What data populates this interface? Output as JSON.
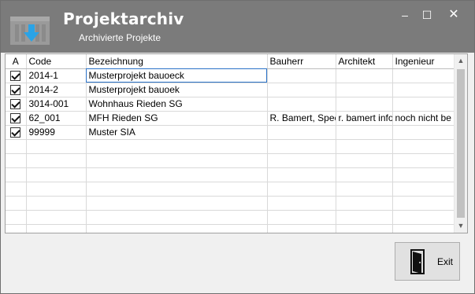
{
  "window": {
    "title": "Projektarchiv",
    "subtitle": "Archivierte Projekte",
    "controls": {
      "minimize": "–",
      "maximize": "☐",
      "close": "✕"
    },
    "colors": {
      "titlebar": "#7b7b7b",
      "accent_arrow": "#2aa3e6",
      "selection": "#2a72c8"
    }
  },
  "grid": {
    "columns": [
      "A",
      "Code",
      "Bezeichnung",
      "Bauherr",
      "Architekt",
      "Ingenieur"
    ],
    "rows": [
      {
        "checked": true,
        "code": "2014-1",
        "bezeichnung": "Musterprojekt bauoeck",
        "bauherr": "",
        "architekt": "",
        "ingenieur": ""
      },
      {
        "checked": true,
        "code": "2014-2",
        "bezeichnung": "Musterprojekt bauoek",
        "bauherr": "",
        "architekt": "",
        "ingenieur": ""
      },
      {
        "checked": true,
        "code": "3014-001",
        "bezeichnung": "Wohnhaus Rieden SG",
        "bauherr": "",
        "architekt": "",
        "ingenieur": ""
      },
      {
        "checked": true,
        "code": "62_001",
        "bezeichnung": "MFH Rieden SG",
        "bauherr": "R. Bamert, Spee",
        "architekt": "r. bamert info",
        "ingenieur": "noch nicht be"
      },
      {
        "checked": true,
        "code": "99999",
        "bezeichnung": "Muster SIA",
        "bauherr": "",
        "architekt": "",
        "ingenieur": ""
      }
    ],
    "empty_rows": 7,
    "selected_row": 0
  },
  "footer": {
    "exit_label": "Exit",
    "exit_icon": "door-exit-icon"
  }
}
